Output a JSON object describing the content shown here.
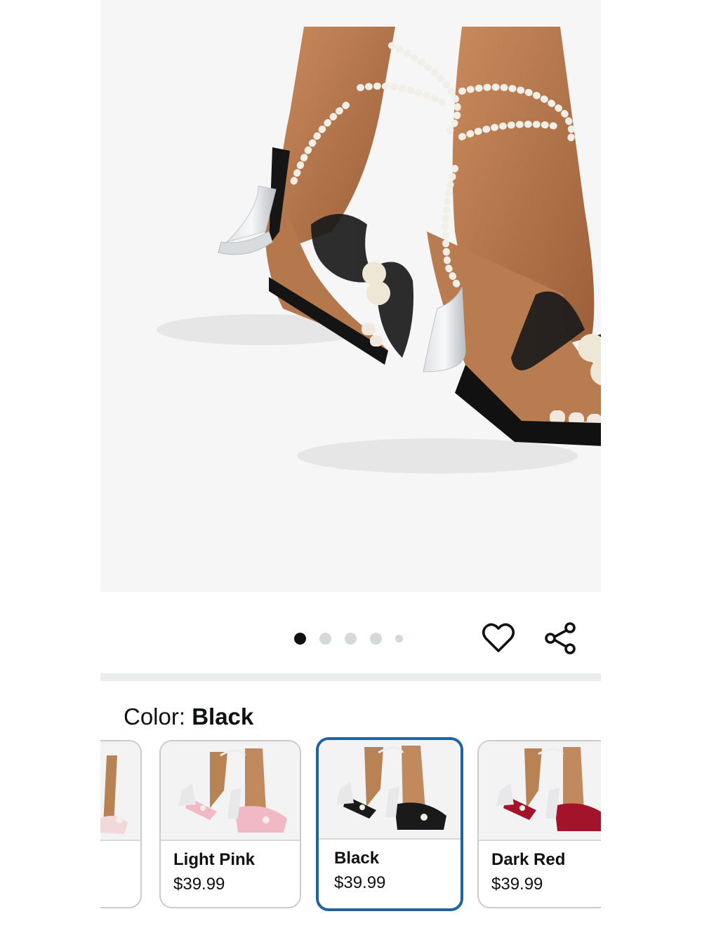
{
  "product": {
    "image_alt": "Black bow pearl clear heel sandals",
    "carousel": {
      "total": 5,
      "active_index": 0
    }
  },
  "actions": {
    "wishlist_icon": "heart-icon",
    "share_icon": "share-icon"
  },
  "color_selector": {
    "label": "Color:",
    "selected": "Black",
    "options": [
      {
        "name": "",
        "price": "",
        "accent": "#f2d7db"
      },
      {
        "name": "Light Pink",
        "price": "$39.99",
        "accent": "#f1b9c4"
      },
      {
        "name": "Black",
        "price": "$39.99",
        "accent": "#1a1a1a"
      },
      {
        "name": "Dark Red",
        "price": "$39.99",
        "accent": "#a3142a"
      }
    ]
  },
  "colors": {
    "selected_border": "#2162a1",
    "text": "#0f1111",
    "divider": "#eaeded"
  }
}
